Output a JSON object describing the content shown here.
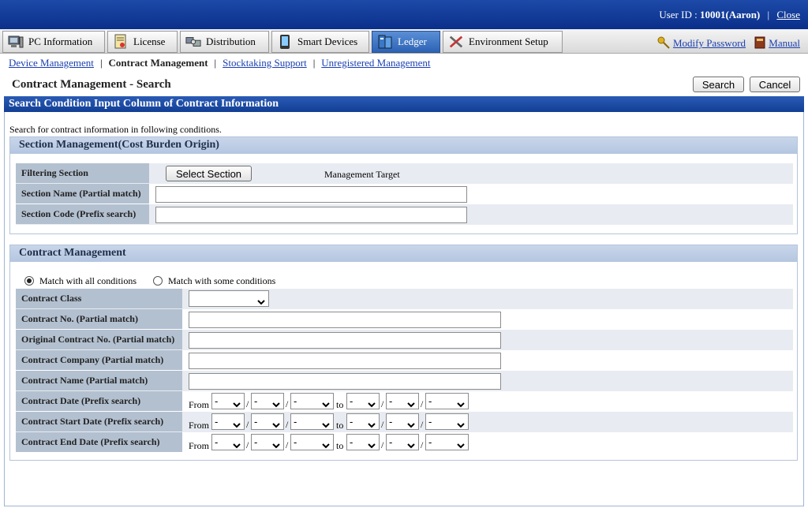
{
  "header": {
    "user_label": "User ID : ",
    "user_value": "10001(Aaron)",
    "separator": "|",
    "close_label": "Close"
  },
  "tabs": [
    {
      "label": "PC Information",
      "icon": "pc-icon"
    },
    {
      "label": "License",
      "icon": "license-icon"
    },
    {
      "label": "Distribution",
      "icon": "distribution-icon"
    },
    {
      "label": "Smart Devices",
      "icon": "smartphone-icon"
    },
    {
      "label": "Ledger",
      "icon": "ledger-icon",
      "active": true
    },
    {
      "label": "Environment Setup",
      "icon": "tools-icon"
    }
  ],
  "tools": {
    "modify_password": "Modify Password",
    "manual": "Manual"
  },
  "subnav": {
    "items": [
      "Device Management",
      "Contract Management",
      "Stocktaking Support",
      "Unregistered Management"
    ],
    "current": 1,
    "separator": "|"
  },
  "page": {
    "title": "Contract Management - Search",
    "search_label": "Search",
    "cancel_label": "Cancel"
  },
  "search_header": "Search Condition Input Column of Contract Information",
  "description": "Search for contract information in following conditions.",
  "section_panel": {
    "title": "Section Management(Cost Burden Origin)",
    "filtering_label": "Filtering Section",
    "select_section_label": "Select Section",
    "management_target": "Management Target",
    "name_label": "Section Name (Partial match)",
    "name_value": "",
    "code_label": "Section Code (Prefix search)",
    "code_value": ""
  },
  "contract_panel": {
    "title": "Contract Management",
    "match_all": "Match with all conditions",
    "match_some": "Match with some conditions",
    "class_label": "Contract Class",
    "class_value": "",
    "no_label": "Contract No. (Partial match)",
    "original_no_label": "Original Contract No. (Partial match)",
    "company_label": "Contract Company (Partial match)",
    "name_label": "Contract Name (Partial match)",
    "date_rows": [
      "Contract Date (Prefix search)",
      "Contract Start Date (Prefix search)",
      "Contract End Date (Prefix search)"
    ],
    "from_label": "From",
    "to_label": "to",
    "date_sep": "/",
    "empty_option": "-"
  }
}
